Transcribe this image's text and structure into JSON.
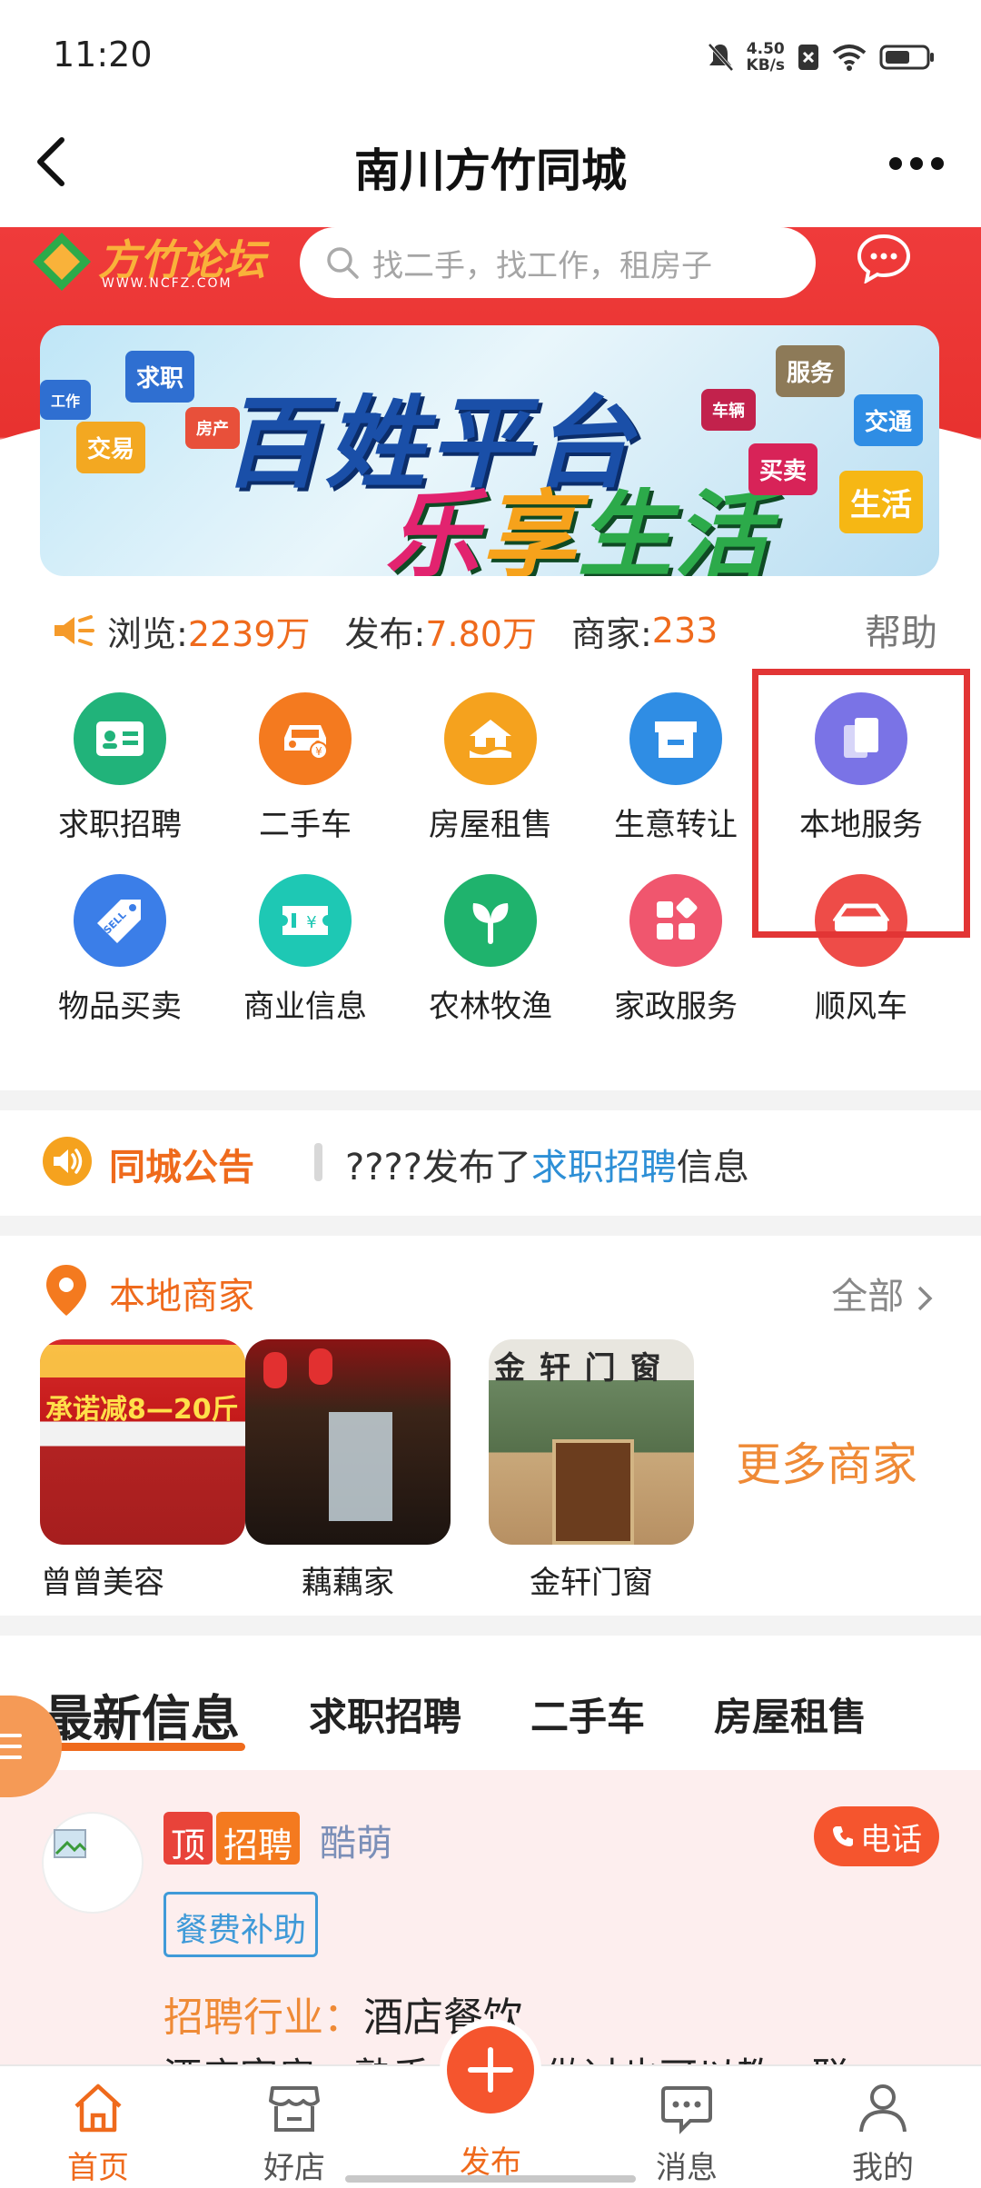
{
  "status_bar": {
    "time": "11:20",
    "net_speed": "4.50",
    "net_unit": "KB/s"
  },
  "header": {
    "title": "南川方竹同城"
  },
  "banner": {
    "logo_text": "方竹论坛",
    "logo_sub": "WWW.NCFZ.COM",
    "search_placeholder": "找二手，找工作，租房子",
    "promo_line1": "百姓平台",
    "promo_line2": [
      "乐",
      "享",
      "生活"
    ],
    "promo_tags": [
      "求职",
      "交易",
      "房产",
      "服务",
      "交通",
      "买卖",
      "生活",
      "车辆",
      "工作"
    ]
  },
  "stats": {
    "views_label": "浏览:",
    "views_value": "2239万",
    "posts_label": "发布:",
    "posts_value": "7.80万",
    "merchants_label": "商家:",
    "merchants_value": "233",
    "help": "帮助"
  },
  "categories": [
    {
      "label": "求职招聘",
      "icon": "id-card-icon",
      "color": "#21b37a"
    },
    {
      "label": "二手车",
      "icon": "car-icon",
      "color": "#f47a1f"
    },
    {
      "label": "房屋租售",
      "icon": "house-icon",
      "color": "#f5a21e"
    },
    {
      "label": "生意转让",
      "icon": "shop-icon",
      "color": "#2f8de4"
    },
    {
      "label": "本地服务",
      "icon": "copy-icon",
      "color": "#7a73e6"
    },
    {
      "label": "物品买卖",
      "icon": "sell-tag-icon",
      "color": "#3b7ee8"
    },
    {
      "label": "商业信息",
      "icon": "ticket-icon",
      "color": "#1ec8b4"
    },
    {
      "label": "农林牧渔",
      "icon": "sprout-icon",
      "color": "#1fb36d"
    },
    {
      "label": "家政服务",
      "icon": "grid-icon",
      "color": "#f0566e"
    },
    {
      "label": "顺风车",
      "icon": "car-front-icon",
      "color": "#ee4c48"
    }
  ],
  "notice": {
    "title": "同城公告",
    "prefix": "????发布了",
    "link": "求职招聘",
    "suffix": "信息"
  },
  "merchants": {
    "title": "本地商家",
    "all_link": "全部",
    "more": "更多商家",
    "items": [
      {
        "name": "曾曾美容",
        "sign": "承诺减8—20斤"
      },
      {
        "name": "藕藕家"
      },
      {
        "name": "金轩门窗",
        "sign": "金 轩 门 窗"
      }
    ]
  },
  "tabs": [
    "最新信息",
    "求职招聘",
    "二手车",
    "房屋租售"
  ],
  "listing": {
    "badge_top": "顶",
    "badge_type": "招聘",
    "poster": "酷萌",
    "phone_label": "电话",
    "benefit": "餐费补助",
    "industry_label": "招聘行业：",
    "industry_value": "酒店餐饮",
    "desc": "酒店客房，熟手……没做过也可以教，联"
  },
  "bottom_nav": [
    {
      "label": "首页",
      "icon": "home-icon"
    },
    {
      "label": "好店",
      "icon": "store-icon"
    },
    {
      "label": "发布",
      "icon": "plus-icon"
    },
    {
      "label": "消息",
      "icon": "message-icon"
    },
    {
      "label": "我的",
      "icon": "user-icon"
    }
  ],
  "colors": {
    "accent": "#ef6a1c",
    "banner_red": "#e8322f",
    "link_blue": "#2d8fd6",
    "highlight": "#e23535"
  }
}
